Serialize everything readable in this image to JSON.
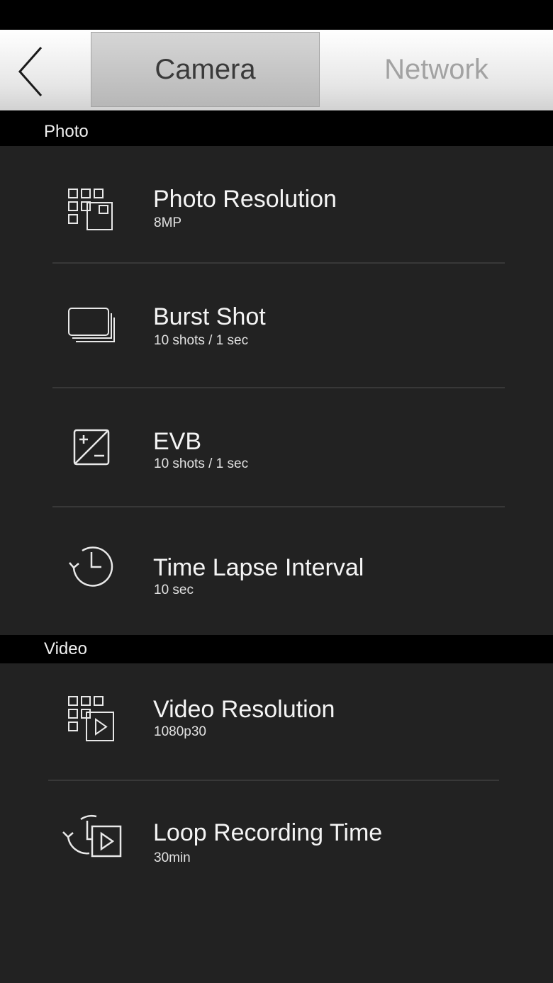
{
  "header": {
    "back_icon": "chevron-left-icon",
    "tabs": [
      {
        "label": "Camera",
        "selected": true
      },
      {
        "label": "Network",
        "selected": false
      }
    ]
  },
  "colors": {
    "background": "#222222",
    "section_header": "#000000",
    "tab_selected": "#bfbfbf",
    "tab_unselected_text": "#a2a2a2"
  },
  "sections": {
    "photo": {
      "label": "Photo",
      "items": [
        {
          "title": "Photo Resolution",
          "value": "8MP",
          "icon": "photo-resolution-icon"
        },
        {
          "title": "Burst Shot",
          "value": "10 shots / 1 sec",
          "icon": "burst-shot-icon"
        },
        {
          "title": "EVB",
          "value": "10 shots / 1 sec",
          "icon": "exposure-icon"
        },
        {
          "title": "Time Lapse Interval",
          "value": "10 sec",
          "icon": "time-lapse-icon"
        }
      ]
    },
    "video": {
      "label": "Video",
      "items": [
        {
          "title": "Video Resolution",
          "value": "1080p30",
          "icon": "video-resolution-icon"
        },
        {
          "title": "Loop Recording Time",
          "value": "30min",
          "icon": "loop-recording-icon"
        }
      ]
    }
  }
}
